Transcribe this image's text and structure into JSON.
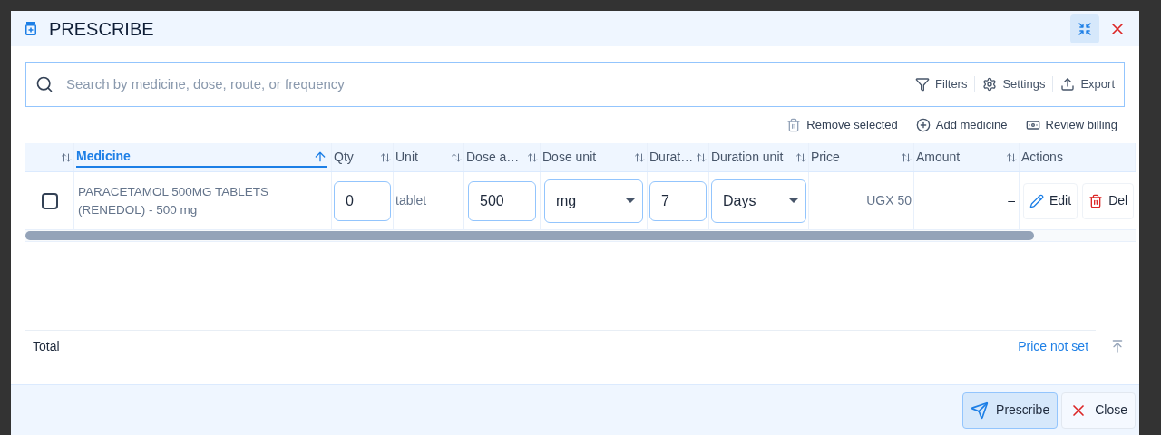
{
  "dialog": {
    "title": "PRESCRIBE"
  },
  "search": {
    "placeholder": "Search by medicine, dose, route, or frequency"
  },
  "search_actions": [
    {
      "label": "Filters",
      "kind": "filter"
    },
    {
      "label": "Settings",
      "kind": "settings"
    },
    {
      "label": "Export",
      "kind": "export"
    }
  ],
  "toolbar": [
    {
      "label": "Remove selected",
      "kind": "remove"
    },
    {
      "label": "Add medicine",
      "kind": "add"
    },
    {
      "label": "Review billing",
      "kind": "billing"
    }
  ],
  "table": {
    "columns": [
      {
        "kind": "select",
        "sorted": false
      },
      {
        "kind": "text",
        "label": "Medicine",
        "sorted": true
      },
      {
        "kind": "text",
        "label": "Qty",
        "sorted": false
      },
      {
        "kind": "text",
        "label": "Unit",
        "sorted": false
      },
      {
        "kind": "text",
        "label": "Dose a…",
        "sorted": false
      },
      {
        "kind": "text",
        "label": "Dose unit",
        "sorted": false
      },
      {
        "kind": "text",
        "label": "Durat…",
        "sorted": false
      },
      {
        "kind": "text",
        "label": "Duration unit",
        "sorted": false
      },
      {
        "kind": "text",
        "label": "Price",
        "sorted": false
      },
      {
        "kind": "text",
        "label": "Amount",
        "sorted": false
      },
      {
        "kind": "actions",
        "label": "Actions"
      }
    ],
    "rows": [
      {
        "selected": false,
        "medicine": "PARACETAMOL 500MG TABLETS (RENEDOL) - 500 mg",
        "qty": "0",
        "unit": "tablet",
        "dose_amount": "500",
        "dose_unit": "mg",
        "duration": "7",
        "duration_unit": "Days",
        "price": "UGX 50",
        "amount": "–",
        "actions": [
          {
            "label": "Edit",
            "kind": "edit"
          },
          {
            "label": "Del",
            "kind": "delete"
          }
        ]
      }
    ]
  },
  "total": {
    "label": "Total",
    "value": "Price not set"
  },
  "footer_buttons": [
    {
      "label": "Prescribe",
      "kind": "primary"
    },
    {
      "label": "Close",
      "kind": "close"
    }
  ]
}
